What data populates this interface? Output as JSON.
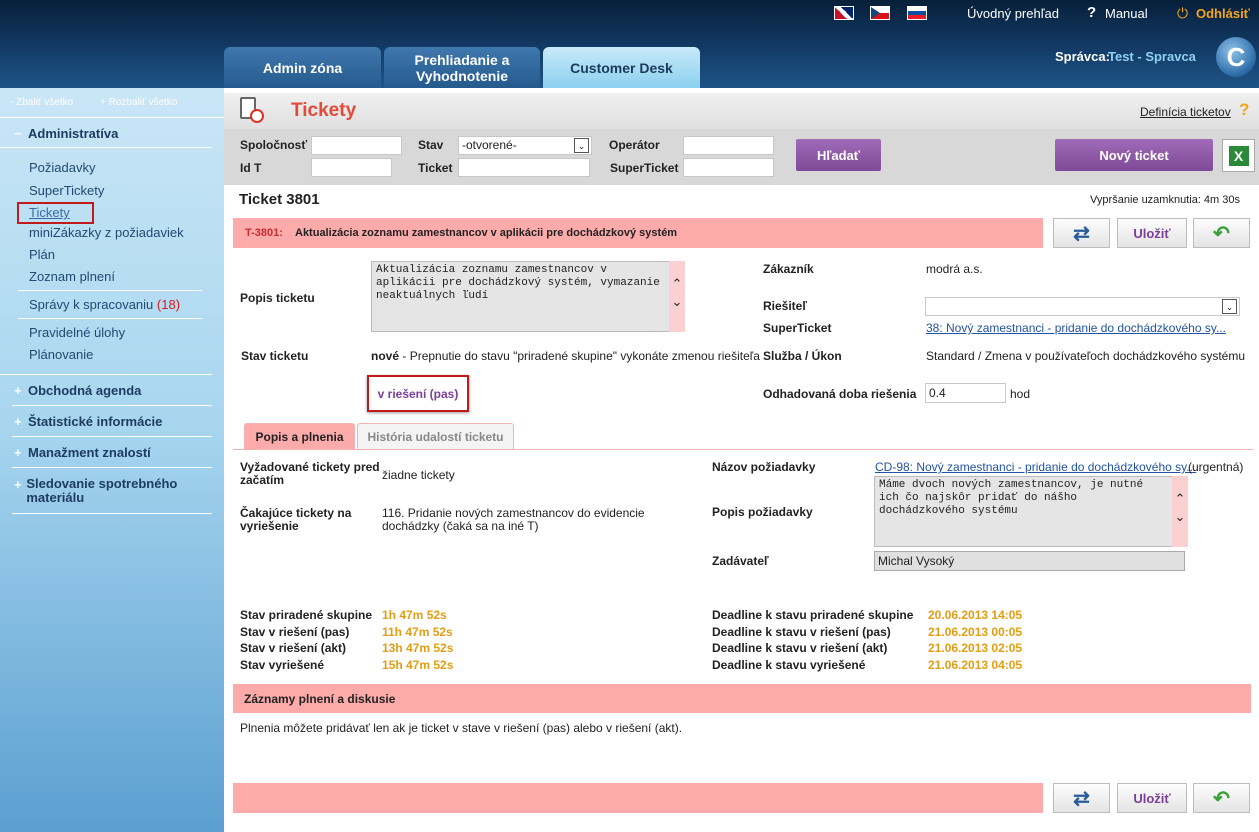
{
  "top": {
    "home": "Úvodný prehľad",
    "manual": "Manual",
    "logout": "Odhlásiť",
    "admin_label": "Správca:",
    "admin_user": "Test - Spravca",
    "logo": "C"
  },
  "tabs": [
    "Admin zóna",
    "Prehliadanie a Vyhodnotenie",
    "Customer Desk"
  ],
  "sidebar": {
    "collapse_all": "- Zbaliť všetko",
    "expand_all": "+ Rozbaliť všetko",
    "section_admin": "Administratíva",
    "items": [
      "Požiadavky",
      "SuperTickety",
      "Tickety",
      "miniZákazky z požiadaviek",
      "Plán",
      "Zoznam plnení"
    ],
    "item_spravy": "Správy k spracovaniu",
    "spravy_count": "(18)",
    "item_ulohy": "Pravidelné úlohy",
    "item_planovanie": "Plánovanie",
    "sections": [
      "Obchodná agenda",
      "Štatistické informácie",
      "Manažment znalostí",
      "Sledovanie spotrebného materiálu"
    ]
  },
  "page": {
    "title": "Tickety",
    "definition_link": "Definícia ticketov",
    "help": "?"
  },
  "filter": {
    "company_label": "Spoločnosť",
    "state_label": "Stav",
    "state_value": "-otvorené-",
    "operator_label": "Operátor",
    "id_label": "Id T",
    "ticket_label": "Ticket",
    "superticket_label": "SuperTicket",
    "search_btn": "Hľadať",
    "new_ticket_btn": "Nový ticket"
  },
  "ticket": {
    "heading": "Ticket 3801",
    "lock_expiry": "Vypršanie uzamknutia: 4m 30s",
    "code": "T-3801:",
    "name": "Aktualizácia zoznamu zamestnancov v aplikácii pre dochádzkový systém",
    "save": "Uložiť",
    "desc_label": "Popis ticketu",
    "desc_text": "Aktualizácia zoznamu zamestnancov v aplikácii pre dochádzkový systém, vymazanie neaktuálnych ľudí",
    "customer_label": "Zákazník",
    "customer_value": "modrá a.s.",
    "solver_label": "Riešiteľ",
    "superticket_label": "SuperTicket",
    "superticket_value": "38: Nový zamestnanci - pridanie do dochádzkového sy...",
    "state_label": "Stav ticketu",
    "state_value": "nové",
    "state_hint": "- Prepnutie do stavu \"priradené skupine\" vykonáte zmenou riešiteľa",
    "state_btn": "v riešení (pas)",
    "service_label": "Služba / Úkon",
    "service_value": "Standard / Zmena v používateľoch dochádzkového systému",
    "estimate_label": "Odhadovaná doba riešenia",
    "estimate_value": "0.4",
    "estimate_unit": "hod"
  },
  "subtabs": [
    "Popis a plnenia",
    "História udalostí ticketu"
  ],
  "detail": {
    "required_label": "Vyžadované tickety pred začatím",
    "required_value": "žiadne tickety",
    "waiting_label": "Čakajúce tickety na vyriešenie",
    "waiting_value": "116.  Pridanie nových zamestnancov do evidencie dochádzky (čaká sa na iné T)",
    "req_name_label": "Názov požiadavky",
    "req_name_value": "CD-98: Nový zamestnanci - pridanie do dochádzkového sy...",
    "req_name_suffix": "(urgentná)",
    "req_desc_label": "Popis požiadavky",
    "req_desc_value": "Máme dvoch nových zamestnancov, je nutné ich čo najskôr pridať do nášho dochádzkového systému",
    "requester_label": "Zadávateľ",
    "requester_value": "Michal Vysoký"
  },
  "times": [
    {
      "label": "Stav priradené skupine",
      "value": "1h 47m 52s",
      "dl_label": "Deadline k stavu priradené skupine",
      "dl_value": "20.06.2013 14:05"
    },
    {
      "label": "Stav v riešení (pas)",
      "value": "11h 47m 52s",
      "dl_label": "Deadline k stavu v riešení (pas)",
      "dl_value": "21.06.2013 00:05"
    },
    {
      "label": "Stav v riešení (akt)",
      "value": "13h 47m 52s",
      "dl_label": "Deadline k stavu v riešení (akt)",
      "dl_value": "21.06.2013 02:05"
    },
    {
      "label": "Stav vyriešené",
      "value": "15h 47m 52s",
      "dl_label": "Deadline k stavu vyriešené",
      "dl_value": "21.06.2013 04:05"
    }
  ],
  "records": {
    "title": "Záznamy plnení a diskusie",
    "note": "Plnenia môžete pridávať len ak je ticket v stave v riešení (pas) alebo v riešení (akt)."
  }
}
